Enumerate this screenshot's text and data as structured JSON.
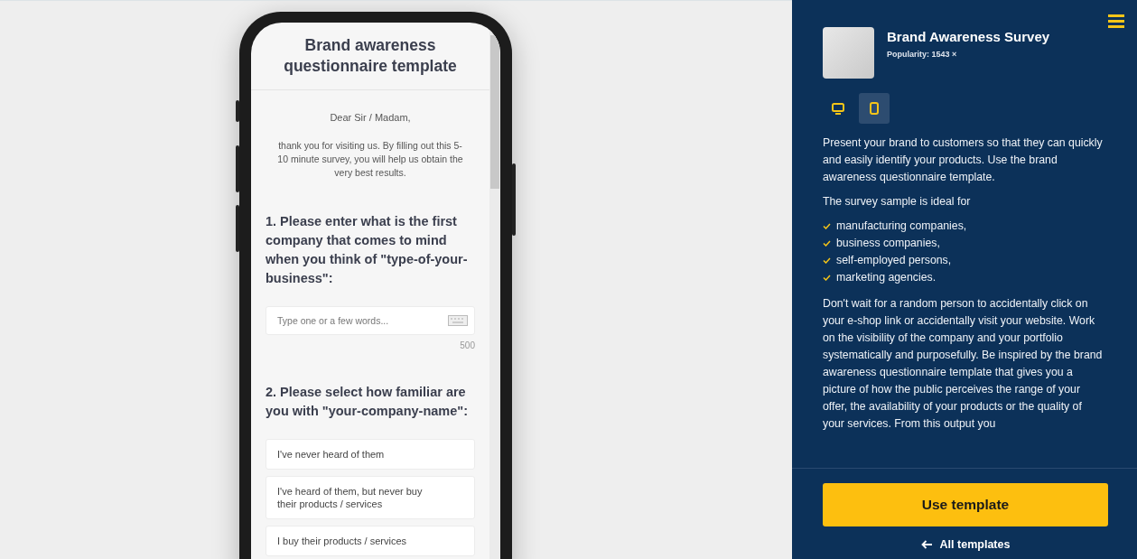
{
  "preview": {
    "title": "Brand awareness questionnaire template",
    "greeting": "Dear Sir / Madam,",
    "intro": "thank you for visiting us. By filling out this 5-10 minute survey, you will help us obtain the very best results.",
    "questions": [
      {
        "kind": "text",
        "title": "1. Please enter what is the first company that comes to mind when you think of \"type-of-your-business\":",
        "placeholder": "Type one or a few words...",
        "limit": "500"
      },
      {
        "kind": "choice",
        "title": "2. Please select how familiar are you with \"your-company-name\":",
        "options": [
          "I've never heard of them",
          "I've heard of them, but never buy their products / services",
          "I buy their products / services"
        ]
      }
    ]
  },
  "panel": {
    "title": "Brand Awareness Survey",
    "popularity": "Popularity: 1543 ×",
    "devices": [
      {
        "kind": "desktop",
        "selected": false
      },
      {
        "kind": "mobile",
        "selected": true
      }
    ],
    "intro": "Present your brand to customers so that they can quickly and easily identify your products. Use the brand awareness questionnaire template.",
    "list_title": "The survey sample is ideal for",
    "list": [
      "manufacturing companies,",
      "business companies,",
      "self-employed persons,",
      "marketing agencies."
    ],
    "body": "Don't wait for a random person to accidentally click on your e-shop link or accidentally visit your website. Work on the visibility of the company and your portfolio systematically and purposefully. Be inspired by the brand awareness questionnaire template that gives you a picture of how the public perceives the range of your offer, the availability of your products or the quality of your services. From this output you",
    "use_button": "Use template",
    "back_link": "All templates"
  }
}
